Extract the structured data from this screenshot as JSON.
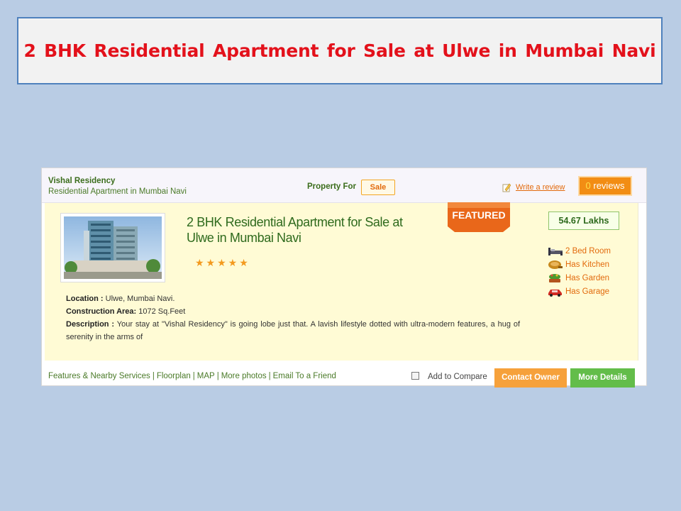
{
  "banner": {
    "title": "2 BHK Residential  Apartment  for Sale at Ulwe in Mumbai  Navi"
  },
  "header": {
    "project_name": "Vishal Residency",
    "subtitle": "Residential Apartment in Mumbai Navi",
    "property_for_label": "Property For",
    "property_for_value": "Sale",
    "write_review": "Write a review",
    "reviews_count": "0",
    "reviews_label": " reviews"
  },
  "listing": {
    "title": "2 BHK Residential Apartment for Sale at Ulwe in Mumbai Navi",
    "stars": "★★★★★",
    "rating": 5,
    "featured_label": "FEATURED",
    "price": "54.67 Lakhs",
    "features": [
      {
        "icon": "bed-icon",
        "label": "2 Bed Room"
      },
      {
        "icon": "kitchen-icon",
        "label": "Has Kitchen"
      },
      {
        "icon": "garden-icon",
        "label": "Has Garden"
      },
      {
        "icon": "garage-icon",
        "label": "Has Garage"
      }
    ],
    "location_label": "Location :",
    "location_value": "Ulwe, Mumbai Navi.",
    "area_label": "Construction Area:",
    "area_value": "1072 Sq.Feet",
    "description_label": "Description :",
    "description_value": "Your stay at \"Vishal Residency\" is going lobe just that. A lavish lifestyle dotted with ultra-modern features, a hug of serenity in the arms of"
  },
  "footer": {
    "links": [
      "Features & Nearby Services",
      "Floorplan",
      "MAP",
      "More photos",
      "Email To a Friend"
    ],
    "compare_label": "Add to Compare",
    "contact_button": "Contact Owner",
    "more_button": "More Details"
  },
  "colors": {
    "background": "#b9cce4",
    "banner_title": "#e3111b",
    "green_text": "#2e6a1d",
    "orange_accent": "#f28d14",
    "body_bg": "#fffbd5",
    "contact_btn": "#f6a13b",
    "more_btn": "#63bd4a"
  }
}
